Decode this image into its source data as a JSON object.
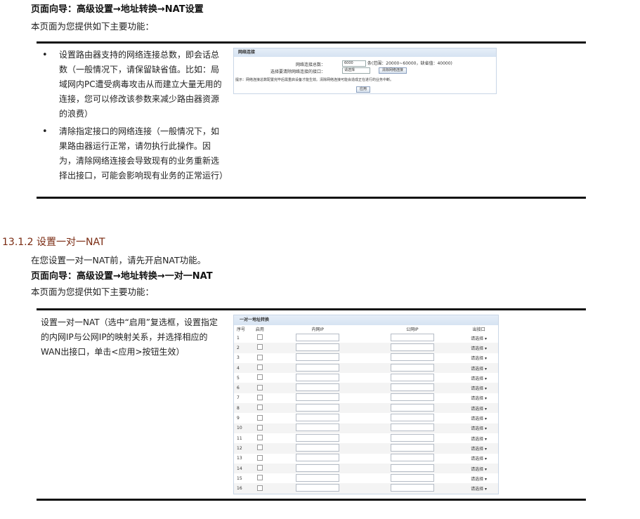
{
  "section1": {
    "nav": "页面向导：高级设置→地址转换→NAT设置",
    "intro": "本页面为您提供如下主要功能：",
    "bullets": [
      "设置路由器支持的网络连接总数，即会话总数（一般情况下，请保留缺省值。比如：局域网内PC遭受病毒攻击从而建立大量无用的连接，您可以修改该参数来减少路由器资源的浪费）",
      "清除指定接口的网络连接（一般情况下，如果路由器运行正常，请勿执行此操作。因为，清除网络连接会导致现有的业务重新选择出接口，可能会影响现有业务的正常运行）"
    ],
    "screenshot": {
      "title": "网络连接",
      "total_label": "网络连接总数：",
      "total_value": "6000",
      "total_hint": "条(范围：20000~60000，缺省值：40000)",
      "clear_label": "选择要清除网络连接的接口：",
      "clear_select": "请选择",
      "clear_button": "清除网络连接",
      "tip": "提示：网络连接总数配置完毕后需重启设备才能生效。清除网络连接可能会造成正在进行的业务中断。",
      "apply": "应用"
    }
  },
  "section2": {
    "heading": "13.1.2  设置一对一NAT",
    "pre": "在您设置一对一NAT前，请先开启NAT功能。",
    "nav": "页面向导：高级设置→地址转换→一对一NAT",
    "intro": "本页面为您提供如下主要功能：",
    "desc": "设置一对一NAT（选中“启用”复选框，设置指定的内网IP与公网IP的映射关系，并选择相应的WAN出接口，单击<应用>按钮生效）",
    "table": {
      "title": "一对一地址转换",
      "headers": [
        "序号",
        "启用",
        "内网IP",
        "公网IP",
        "出接口"
      ],
      "select_label": "请选择",
      "rows": [
        "1",
        "2",
        "3",
        "4",
        "5",
        "6",
        "7",
        "8",
        "9",
        "10",
        "11",
        "12",
        "13",
        "14",
        "15",
        "16"
      ]
    }
  }
}
